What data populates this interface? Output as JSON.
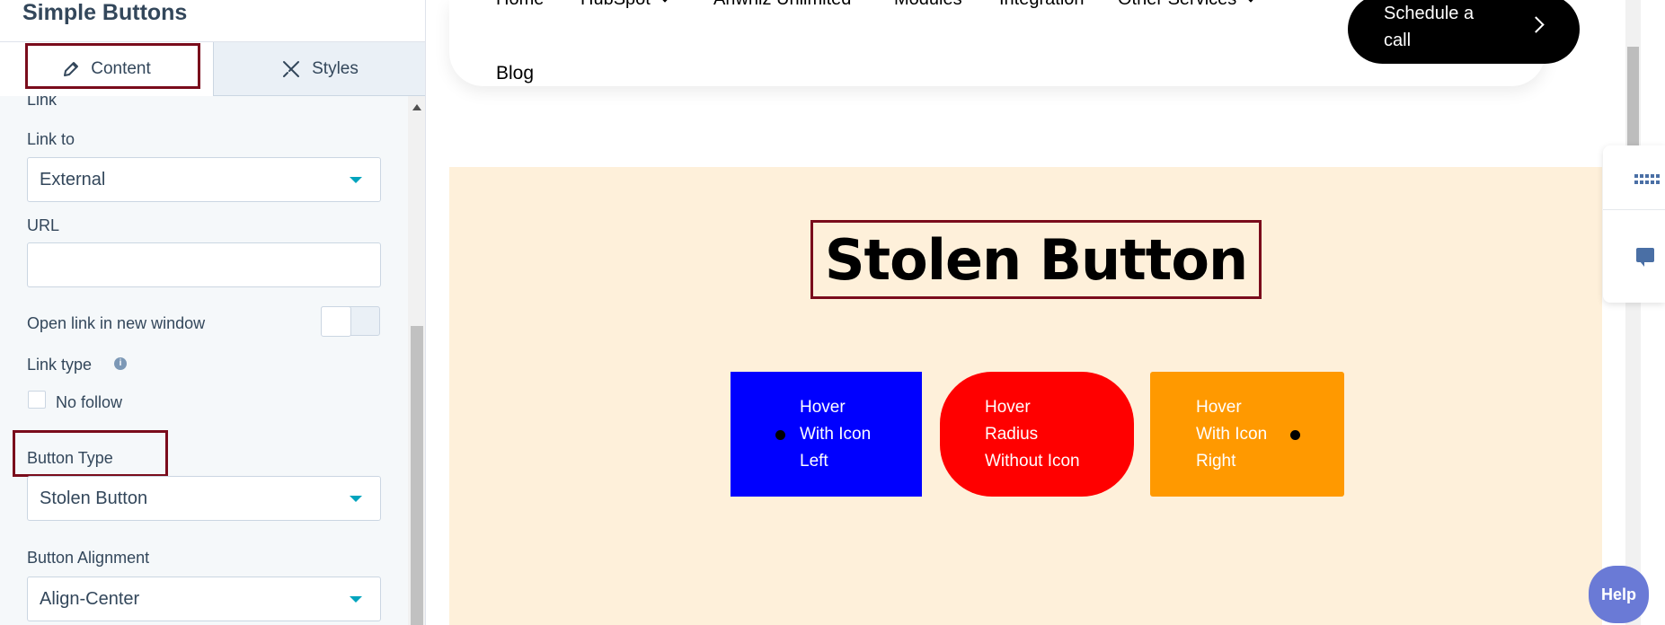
{
  "panel": {
    "title": "Simple Buttons",
    "tabs": [
      {
        "label": "Content",
        "icon": "pencil-icon",
        "active": true
      },
      {
        "label": "Styles",
        "icon": "brush-icon",
        "active": false
      }
    ],
    "section_label": "Link",
    "link_to": {
      "label": "Link to",
      "value": "External"
    },
    "url": {
      "label": "URL",
      "value": ""
    },
    "new_window": {
      "label": "Open link in new window",
      "on": false
    },
    "link_type": {
      "label": "Link type",
      "info_icon": "info-icon"
    },
    "no_follow": {
      "label": "No follow",
      "checked": false
    },
    "button_type": {
      "label": "Button Type",
      "value": "Stolen Button"
    },
    "button_alignment": {
      "label": "Button Alignment",
      "value": "Align-Center"
    }
  },
  "preview": {
    "nav": [
      {
        "label": "Home",
        "dropdown": false
      },
      {
        "label": "HubSpot",
        "dropdown": true
      },
      {
        "label": "Ariwhiz Unlimited",
        "dropdown": false
      },
      {
        "label": "Modules",
        "dropdown": false
      },
      {
        "label": "Integration",
        "dropdown": false
      },
      {
        "label": "Other Services",
        "dropdown": true
      }
    ],
    "blog": "Blog",
    "cta": {
      "line1": "Schedule a",
      "line2": "call"
    },
    "heading": "Stolen Button",
    "buttons": [
      {
        "lines": [
          "Hover",
          "With Icon",
          "Left"
        ],
        "color": "#0000ff"
      },
      {
        "lines": [
          "Hover",
          "Radius",
          "Without Icon"
        ],
        "color": "#ff0000"
      },
      {
        "lines": [
          "Hover",
          "With Icon",
          "Right"
        ],
        "color": "#ff9900"
      }
    ],
    "help": "Help"
  },
  "colors": {
    "highlight": "#7a0c1c",
    "section_bg": "#fef0da",
    "caret": "#00a4bd"
  }
}
